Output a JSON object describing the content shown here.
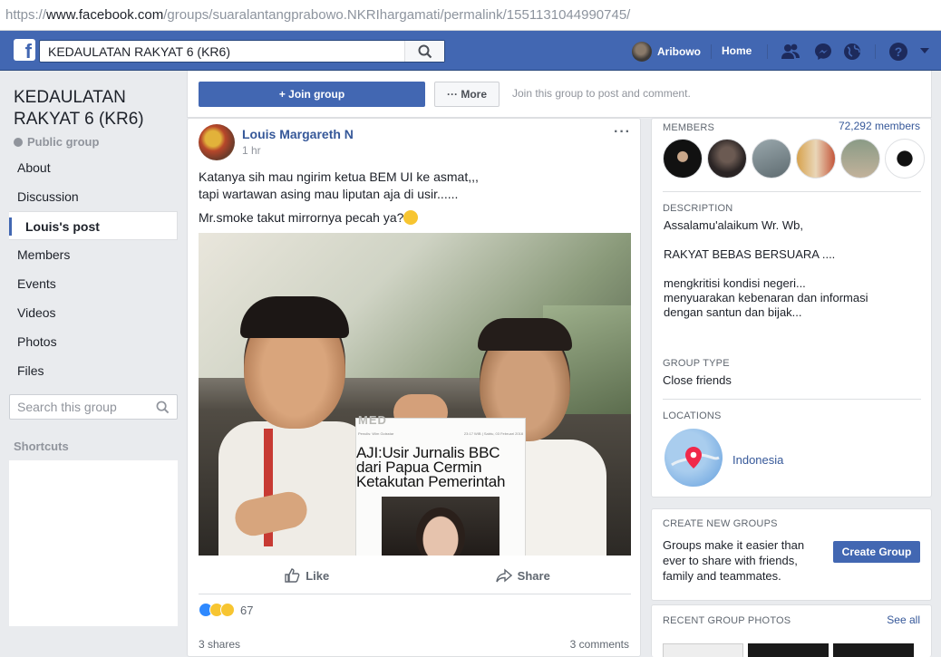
{
  "browser": {
    "url_scheme": "https://",
    "url_host": "www.facebook.com",
    "url_path": "/groups/suaralantangprabowo.NKRIhargamati/permalink/1551131044990745/"
  },
  "topbar": {
    "logo": "f",
    "search_value": "KEDAULATAN RAKYAT 6 (KR6)",
    "user_name": "Aribowo",
    "home_label": "Home",
    "brand_color": "#4267b2",
    "icons": [
      "friends-icon",
      "messenger-icon",
      "globe-icon",
      "help-icon",
      "caret-down-icon"
    ]
  },
  "sidebar": {
    "group_title": "KEDAULATAN RAKYAT 6 (KR6)",
    "privacy": "Public group",
    "items": [
      {
        "label": "About"
      },
      {
        "label": "Discussion"
      },
      {
        "label": "Louis's post",
        "active": true
      },
      {
        "label": "Members"
      },
      {
        "label": "Events"
      },
      {
        "label": "Videos"
      },
      {
        "label": "Photos"
      },
      {
        "label": "Files"
      }
    ],
    "search_placeholder": "Search this group",
    "shortcuts_label": "Shortcuts"
  },
  "actionbar": {
    "join_label": "+ Join group",
    "more_label": "··· More",
    "hint": "Join this group to post and comment."
  },
  "post": {
    "author": "Louis Margareth N",
    "time": "1 hr",
    "menu": "···",
    "text_line1": "Katanya sih mau ngirim ketua BEM UI ke asmat,,,",
    "text_line2": "tapi wartawan asing mau liputan aja di usir......",
    "text_line3": "Mr.smoke takut mirrornya pecah ya?",
    "image": {
      "paper_masthead": "MED",
      "paper_author": "Penulis: Wim Goisstar",
      "paper_date": "23:17 WIB | Sabtu, 03 Februari 2018",
      "headline_1": "AJI:Usir Jurnalis BBC",
      "headline_2": "dari Papua Cermin",
      "headline_3": "Ketakutan Pemerintah"
    },
    "like_label": "Like",
    "share_label": "Share",
    "reaction_count": "67",
    "shares": "3 shares",
    "comments": "3 comments"
  },
  "right": {
    "members_label": "MEMBERS",
    "members_count": "72,292 members",
    "description_label": "DESCRIPTION",
    "description": "Assalamu'alaikum Wr. Wb,\n\nRAKYAT BEBAS BERSUARA ....\n\nmengkritisi kondisi negeri...\nmenyuarakan kebenaran dan informasi\ndengan santun dan bijak...",
    "group_type_label": "GROUP TYPE",
    "group_type": "Close friends",
    "locations_label": "LOCATIONS",
    "location": "Indonesia",
    "create_label": "CREATE NEW GROUPS",
    "create_text": "Groups make it easier than ever to share with friends, family and teammates.",
    "create_button": "Create Group",
    "photos_label": "RECENT GROUP PHOTOS",
    "see_all": "See all"
  }
}
